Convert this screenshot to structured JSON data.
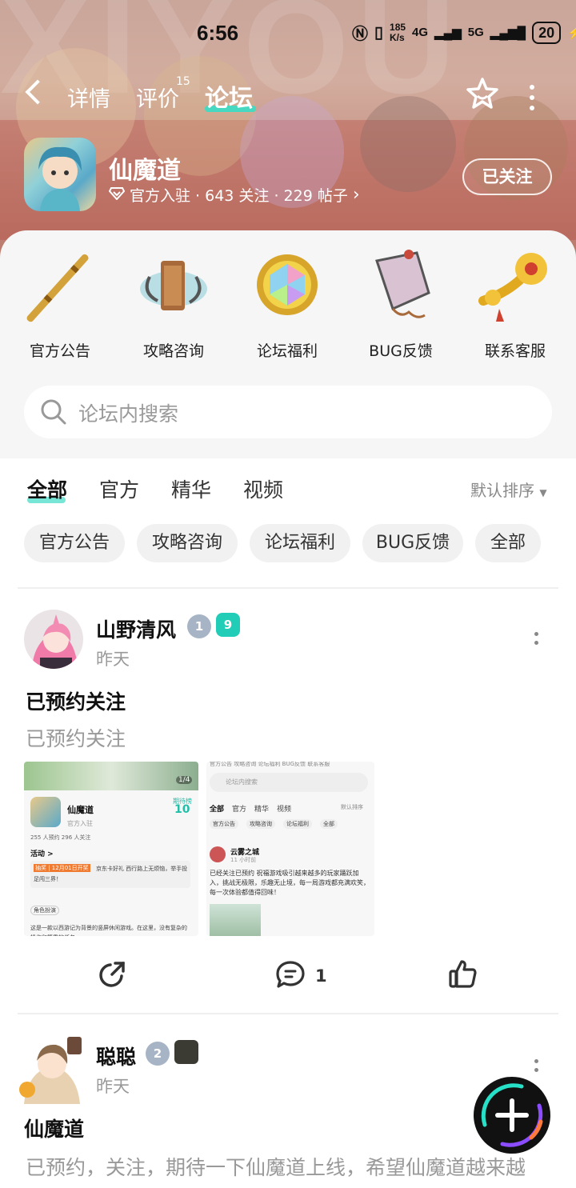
{
  "status_bar": {
    "time": "6:56",
    "speed_value": "185",
    "speed_unit": "K/s",
    "net1": "4G",
    "net2": "5G",
    "battery": "20"
  },
  "nav": {
    "tabs": [
      {
        "label": "详情"
      },
      {
        "label": "评价",
        "count": "15"
      },
      {
        "label": "论坛"
      }
    ],
    "active_tab": "论坛"
  },
  "app": {
    "name": "仙魔道",
    "meta": "官方入驻 · 643 关注 · 229 帖子",
    "follow_label": "已关注"
  },
  "categories": [
    {
      "label": "官方公告",
      "icon": "flute-icon"
    },
    {
      "label": "攻略咨询",
      "icon": "scroll-tablet-icon"
    },
    {
      "label": "论坛福利",
      "icon": "gem-icon"
    },
    {
      "label": "BUG反馈",
      "icon": "kite-icon"
    },
    {
      "label": "联系客服",
      "icon": "ruyi-icon"
    }
  ],
  "search": {
    "placeholder": "论坛内搜索"
  },
  "filter_tabs": [
    "全部",
    "官方",
    "精华",
    "视频"
  ],
  "sort_label": "默认排序",
  "chips": [
    "官方公告",
    "攻略咨询",
    "论坛福利",
    "BUG反馈",
    "全部"
  ],
  "posts": [
    {
      "user": "山野清风",
      "date": "昨天",
      "badge_level": "1",
      "badge_vip": "9",
      "title": "已预约关注",
      "body": "已预约关注",
      "comment_count": "1",
      "thumb_left": {
        "counter": "1/4",
        "app_name": "仙魔道",
        "app_sub": "官方入驻",
        "rank_label": "期待榜",
        "rank_value": "10",
        "stats": "255 人预约    296 人关注",
        "activity": "活动 >",
        "event_tag": "抽奖 | 12月01日开奖",
        "event_text": "京东卡好礼 西行路上无烦恼，举手投足闯三界！",
        "chip": "角色扮演",
        "desc": "这是一款以西游记为背景的竖屏休闲游戏。在这里，没有复杂的操作和繁重的任务"
      },
      "thumb_right": {
        "cats": "官方公告    攻略咨询    论坛福利    BUG反馈    联系客服",
        "search": "论坛内搜索",
        "tabs": [
          "全部",
          "官方",
          "精华",
          "视频"
        ],
        "sort": "默认排序",
        "chips": [
          "官方公告",
          "攻略咨询",
          "论坛福利",
          "全部"
        ],
        "user": "云雾之城",
        "time": "11 小时前",
        "text": "已经关注已预约 祝福游戏吸引越来越多的玩家踊跃加入，挑战无极限，乐趣无止境，每一局游戏都充满欢笑，每一次体验都值得回味！"
      }
    },
    {
      "user": "聪聪",
      "date": "昨天",
      "badge_level": "2",
      "title": "仙魔道",
      "body": "已预约，关注，期待一下仙魔道上线，希望仙魔道越来越"
    }
  ],
  "colors": {
    "accent": "#2ee0c8",
    "header_bg": "#c89486",
    "vip_badge": "#22cdb8"
  }
}
